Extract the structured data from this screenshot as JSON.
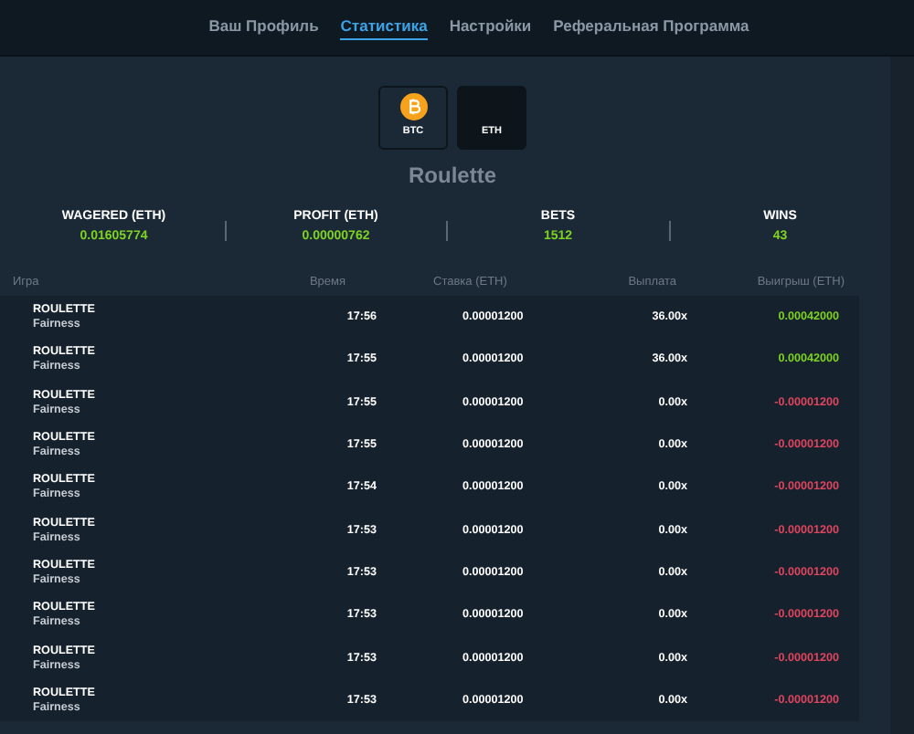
{
  "nav": [
    {
      "label": "Ваш Профиль",
      "selected": false
    },
    {
      "label": "Статистика",
      "selected": true
    },
    {
      "label": "Настройки",
      "selected": false
    },
    {
      "label": "Реферальная Программа",
      "selected": false
    }
  ],
  "coins": [
    {
      "kind": "btc",
      "label": "BTC",
      "selected": false
    },
    {
      "kind": "eth",
      "label": "ETH",
      "selected": true
    }
  ],
  "game_title": "Roulette",
  "stats": [
    {
      "label": "WAGERED (ETH)",
      "value": "0.01605774"
    },
    {
      "label": "PROFIT (ETH)",
      "value": "0.00000762"
    },
    {
      "label": "BETS",
      "value": "1512"
    },
    {
      "label": "WINS",
      "value": "43"
    }
  ],
  "table": {
    "columns": [
      "Игра",
      "Время",
      "Ставка (ETH)",
      "Выплата",
      "Выигрыш (ETH)"
    ],
    "rows": [
      {
        "game": "ROULETTE",
        "link": "Fairness",
        "time": "17:56",
        "bet": "0.00001200",
        "payout": "36.00x",
        "result": "0.00042000",
        "kind": "win"
      },
      {
        "game": "ROULETTE",
        "link": "Fairness",
        "time": "17:55",
        "bet": "0.00001200",
        "payout": "36.00x",
        "result": "0.00042000",
        "kind": "win"
      },
      {
        "game": "ROULETTE",
        "link": "Fairness",
        "time": "17:55",
        "bet": "0.00001200",
        "payout": "0.00x",
        "result": "-0.00001200",
        "kind": "loss"
      },
      {
        "game": "ROULETTE",
        "link": "Fairness",
        "time": "17:55",
        "bet": "0.00001200",
        "payout": "0.00x",
        "result": "-0.00001200",
        "kind": "loss"
      },
      {
        "game": "ROULETTE",
        "link": "Fairness",
        "time": "17:54",
        "bet": "0.00001200",
        "payout": "0.00x",
        "result": "-0.00001200",
        "kind": "loss"
      },
      {
        "game": "ROULETTE",
        "link": "Fairness",
        "time": "17:53",
        "bet": "0.00001200",
        "payout": "0.00x",
        "result": "-0.00001200",
        "kind": "loss"
      },
      {
        "game": "ROULETTE",
        "link": "Fairness",
        "time": "17:53",
        "bet": "0.00001200",
        "payout": "0.00x",
        "result": "-0.00001200",
        "kind": "loss"
      },
      {
        "game": "ROULETTE",
        "link": "Fairness",
        "time": "17:53",
        "bet": "0.00001200",
        "payout": "0.00x",
        "result": "-0.00001200",
        "kind": "loss"
      },
      {
        "game": "ROULETTE",
        "link": "Fairness",
        "time": "17:53",
        "bet": "0.00001200",
        "payout": "0.00x",
        "result": "-0.00001200",
        "kind": "loss"
      },
      {
        "game": "ROULETTE",
        "link": "Fairness",
        "time": "17:53",
        "bet": "0.00001200",
        "payout": "0.00x",
        "result": "-0.00001200",
        "kind": "loss"
      }
    ]
  }
}
